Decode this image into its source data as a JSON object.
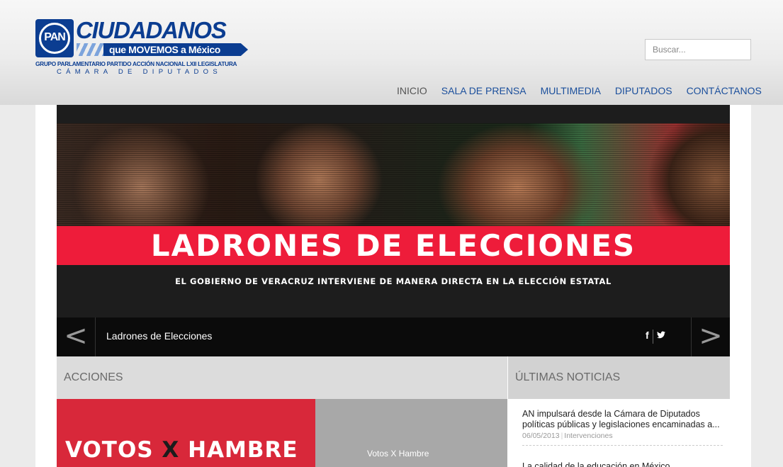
{
  "header": {
    "logo": {
      "badge": "PAN",
      "title": "CIUDADANOS",
      "tagline": "que MOVEMOS a México",
      "line1": "GRUPO PARLAMENTARIO PARTIDO ACCIÓN NACIONAL LXII LEGISLATURA",
      "line2": "CÁMARA DE DIPUTADOS",
      "brand_color": "#0b3d91"
    },
    "search": {
      "placeholder": "Buscar..."
    },
    "nav": [
      "INICIO",
      "SALA DE PRENSA",
      "MULTIMEDIA",
      "DIPUTADOS",
      "CONTÁCTANOS"
    ],
    "nav_active": "INICIO"
  },
  "slider": {
    "title": "LADRONES DE ELECCIONES",
    "subtitle": "EL GOBIERNO DE VERACRUZ INTERVIENE DE MANERA DIRECTA EN LA ELECCIÓN ESTATAL",
    "caption": "Ladrones de Elecciones",
    "prev_icon": "chevron-left-icon",
    "next_icon": "chevron-right-icon",
    "prev_glyph": "<",
    "next_glyph": ">",
    "share": {
      "facebook": "f",
      "twitter": "🐦"
    },
    "accent_color": "#ee1c3a"
  },
  "acciones": {
    "header": "ACCIONES",
    "feature": {
      "title_part1": "VOTOS ",
      "title_x": "X",
      "title_part2": " HAMBRE",
      "label": "Votos X Hambre"
    }
  },
  "noticias": {
    "header": "ÚLTIMAS NOTICIAS",
    "items": [
      {
        "title": "AN impulsará desde la Cámara de Diputados políticas públicas y legislaciones encaminadas a...",
        "date": "06/05/2013",
        "category": "Intervenciones"
      },
      {
        "title": "La calidad de la educación en México..."
      }
    ]
  }
}
